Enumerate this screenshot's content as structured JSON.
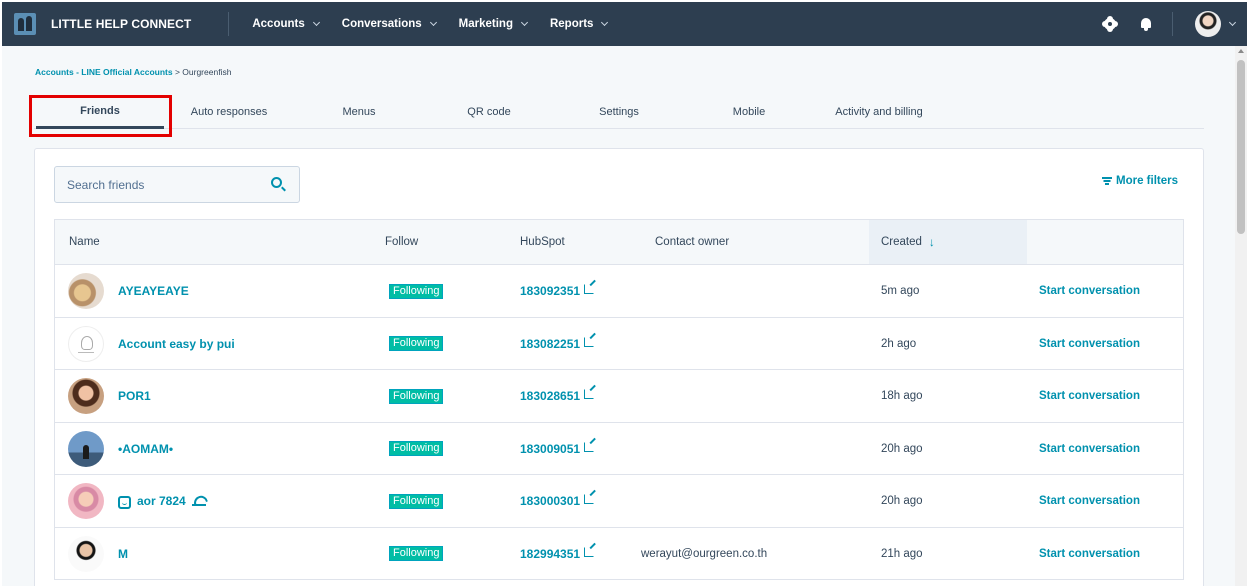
{
  "topnav": {
    "brand": "LITTLE HELP CONNECT",
    "menu": [
      {
        "label": "Accounts"
      },
      {
        "label": "Conversations"
      },
      {
        "label": "Marketing"
      },
      {
        "label": "Reports"
      }
    ]
  },
  "breadcrumb": {
    "link": "Accounts - LINE Official Accounts",
    "separator": " > ",
    "current": "Ourgreenfish"
  },
  "tabs": [
    {
      "label": "Friends",
      "active": true
    },
    {
      "label": "Auto responses"
    },
    {
      "label": "Menus"
    },
    {
      "label": "QR code"
    },
    {
      "label": "Settings"
    },
    {
      "label": "Mobile"
    },
    {
      "label": "Activity and billing"
    }
  ],
  "search": {
    "placeholder": "Search friends"
  },
  "filters": {
    "label": "More filters"
  },
  "table": {
    "headers": {
      "name": "Name",
      "follow": "Follow",
      "hubspot": "HubSpot",
      "owner": "Contact owner",
      "created": "Created",
      "sort_arrow": "↓"
    },
    "rows": [
      {
        "name": "AYEAYEAYE",
        "follow": "Following",
        "hubspot": "183092351",
        "owner": "",
        "created": "5m ago",
        "action": "Start conversation"
      },
      {
        "name": "Account easy by pui",
        "follow": "Following",
        "hubspot": "183082251",
        "owner": "",
        "created": "2h ago",
        "action": "Start conversation"
      },
      {
        "name": "POR1",
        "follow": "Following",
        "hubspot": "183028651",
        "owner": "",
        "created": "18h ago",
        "action": "Start conversation"
      },
      {
        "name": "•AOMAM•",
        "follow": "Following",
        "hubspot": "183009051",
        "owner": "",
        "created": "20h ago",
        "action": "Start conversation"
      },
      {
        "name": "aor 7824",
        "follow": "Following",
        "hubspot": "183000301",
        "owner": "",
        "created": "20h ago",
        "action": "Start conversation"
      },
      {
        "name": "M",
        "follow": "Following",
        "hubspot": "182994351",
        "owner": "werayut@ourgreen.co.th",
        "created": "21h ago",
        "action": "Start conversation"
      }
    ]
  },
  "icons": {
    "logo": "app-logo-icon",
    "settings": "gear-icon",
    "notifications": "bell-icon",
    "search": "search-icon",
    "filter": "filter-icon",
    "edit": "external-edit-icon"
  },
  "colors": {
    "nav_bg": "#2d3e50",
    "accent": "#0091ae",
    "badge": "#00bda5",
    "highlight": "#e30000"
  }
}
